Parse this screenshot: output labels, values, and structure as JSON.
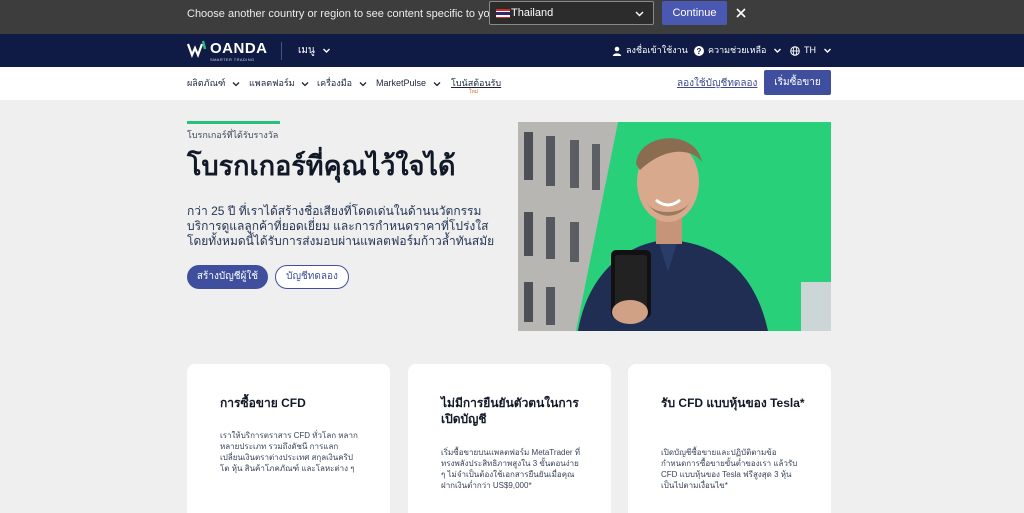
{
  "country_banner": {
    "message": "Choose another country or region to see content specific to your location",
    "selected_country": "Thailand",
    "continue_label": "Continue"
  },
  "header": {
    "logo_text": "OANDA",
    "logo_subtext": "SMARTER TRADING",
    "menu_label": "เมนู",
    "login_label": "ลงชื่อเข้าใช้งาน",
    "help_label": "ความช่วยเหลือ",
    "language_label": "TH"
  },
  "subnav": {
    "items": [
      {
        "label": "ผลิตภัณฑ์"
      },
      {
        "label": "แพลตฟอร์ม"
      },
      {
        "label": "เครื่องมือ"
      },
      {
        "label": "MarketPulse"
      },
      {
        "label": "โบนัสต้อนรับ"
      }
    ],
    "new_badge": "ใหม่",
    "demo_link": "ลองใช้บัญชีทดลอง",
    "start_trading": "เริ่มซื้อขาย"
  },
  "hero": {
    "eyebrow": "โบรกเกอร์ที่ได้รับรางวัล",
    "title": "โบรกเกอร์ที่คุณไว้ใจได้",
    "description": "กว่า 25 ปี ที่เราได้สร้างชื่อเสียงที่โดดเด่นในด้านนวัตกรรม บริการดูแลลูกค้าที่ยอดเยี่ยม และการกำหนดราคาที่โปร่งใส โดยทั้งหมดนี้ได้รับการส่งมอบผ่านแพลตฟอร์มก้าวล้ำทันสมัย",
    "primary_cta": "สร้างบัญชีผู้ใช้",
    "secondary_cta": "บัญชีทดลอง"
  },
  "cards": [
    {
      "title": "การซื้อขาย CFD",
      "text": "เราให้บริการตราสาร CFD ทั่วโลก หลากหลายประเภท รวมถึงดัชนี การแลกเปลี่ยนเงินตราต่างประเทศ สกุลเงินคริปโต หุ้น สินค้าโภคภัณฑ์ และโลหะต่าง ๆ"
    },
    {
      "title": "ไม่มีการยืนยันตัวตนในการเปิดบัญชี",
      "text": "เริ่มซื้อขายบนแพลตฟอร์ม MetaTrader ที่ทรงพลังประสิทธิภาพสูงใน 3 ขั้นตอนง่าย ๆ ไม่จำเป็นต้องใช้เอกสารยืนยันเมื่อคุณฝากเงินต่ำกว่า US$9,000*"
    },
    {
      "title": "รับ CFD แบบหุ้นของ Tesla*",
      "text": "เปิดบัญชีซื้อขายและปฏิบัติตามข้อกำหนดการซื้อขายขั้นต่ำของเรา แล้วรับ CFD แบบหุ้นของ Tesla ฟรีสูงสุด 3 หุ้น เป็นไปตามเงื่อนไข*"
    }
  ],
  "colors": {
    "banner_bg": "#3d3d3d",
    "nav_bg": "#0f1b44",
    "brand_button": "#3f4f9e",
    "accent_green": "#27c07f",
    "page_bg": "#efefef"
  },
  "icons": [
    "thai-flag-icon",
    "chevron-down-icon",
    "close-icon",
    "oanda-logo-icon",
    "user-icon",
    "help-icon",
    "globe-icon"
  ]
}
